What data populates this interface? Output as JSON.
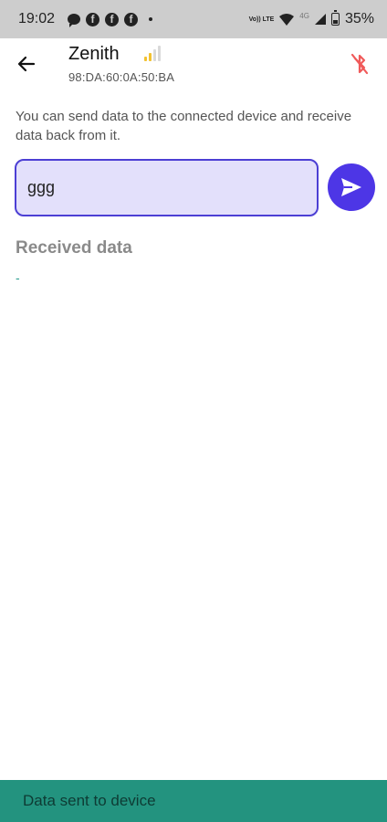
{
  "status_bar": {
    "time": "19:02",
    "network_label": "Vo)) LTE",
    "network_gen": "4G",
    "battery_percent": "35%",
    "battery_level": 0.35
  },
  "app_bar": {
    "back_icon": "arrow-left-icon",
    "device_name": "Zenith",
    "device_mac": "98:DA:60:0A:50:BA",
    "signal_strength_bars": 2,
    "signal_total_bars": 4,
    "signal_color": "#f2c230",
    "signal_inactive_color": "#d9d9d9",
    "bluetooth_icon": "bluetooth-disabled-icon",
    "bluetooth_color": "#f05a5a"
  },
  "main": {
    "description": "You can send data to the connected device and receive data back from it.",
    "input_value": "ggg",
    "send_icon": "send-icon",
    "received_title": "Received data",
    "received_value": "-"
  },
  "snackbar": {
    "message": "Data sent to device"
  },
  "colors": {
    "accent": "#4d36e6",
    "input_bg": "#e3e0fb",
    "snackbar_bg": "#23937f"
  }
}
